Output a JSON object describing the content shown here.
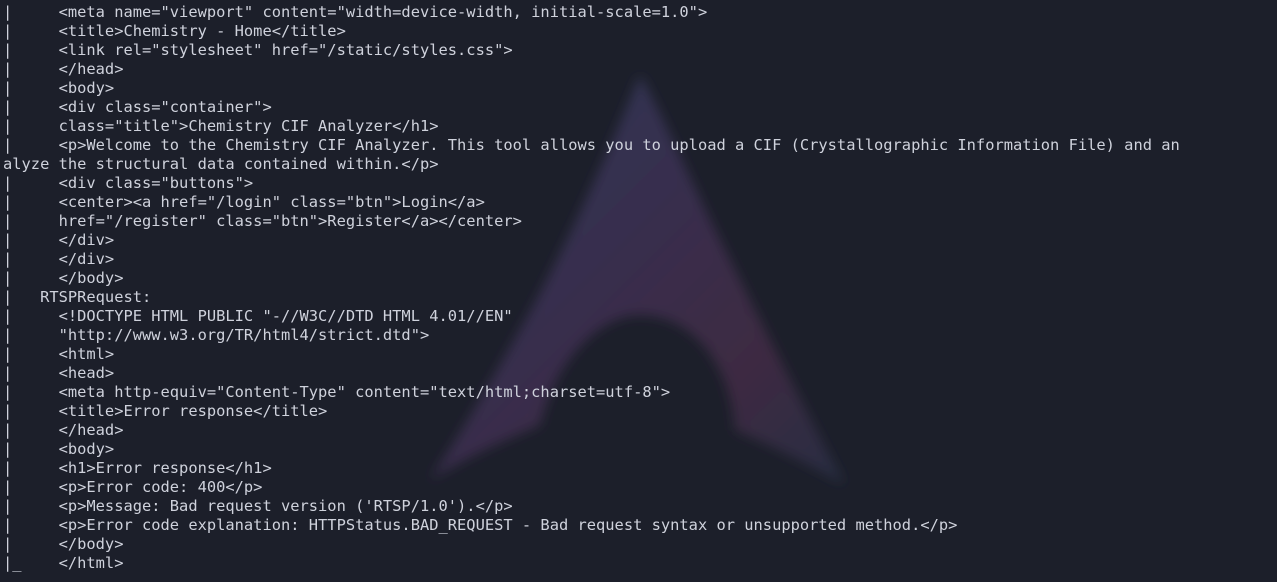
{
  "terminal": {
    "lines": [
      "|     <meta name=\"viewport\" content=\"width=device-width, initial-scale=1.0\">",
      "|     <title>Chemistry - Home</title>",
      "|     <link rel=\"stylesheet\" href=\"/static/styles.css\">",
      "|     </head>",
      "|     <body>",
      "|     <div class=\"container\">",
      "|     class=\"title\">Chemistry CIF Analyzer</h1>",
      "|     <p>Welcome to the Chemistry CIF Analyzer. This tool allows you to upload a CIF (Crystallographic Information File) and an",
      "alyze the structural data contained within.</p>",
      "|     <div class=\"buttons\">",
      "|     <center><a href=\"/login\" class=\"btn\">Login</a>",
      "|     href=\"/register\" class=\"btn\">Register</a></center>",
      "|     </div>",
      "|     </div>",
      "|     </body>",
      "|   RTSPRequest:",
      "|     <!DOCTYPE HTML PUBLIC \"-//W3C//DTD HTML 4.01//EN\"",
      "|     \"http://www.w3.org/TR/html4/strict.dtd\">",
      "|     <html>",
      "|     <head>",
      "|     <meta http-equiv=\"Content-Type\" content=\"text/html;charset=utf-8\">",
      "|     <title>Error response</title>",
      "|     </head>",
      "|     <body>",
      "|     <h1>Error response</h1>",
      "|     <p>Error code: 400</p>",
      "|     <p>Message: Bad request version ('RTSP/1.0').</p>",
      "|     <p>Error code explanation: HTTPStatus.BAD_REQUEST - Bad request syntax or unsupported method.</p>",
      "|     </body>",
      "|_    </html>"
    ]
  },
  "colors": {
    "background": "#1c1f2a",
    "text": "#cfd2dc",
    "logo_blue": "#3c5f8c",
    "logo_magenta": "#8a4a9a"
  },
  "icons": {
    "wallpaper": "arch-linux-logo-icon"
  }
}
